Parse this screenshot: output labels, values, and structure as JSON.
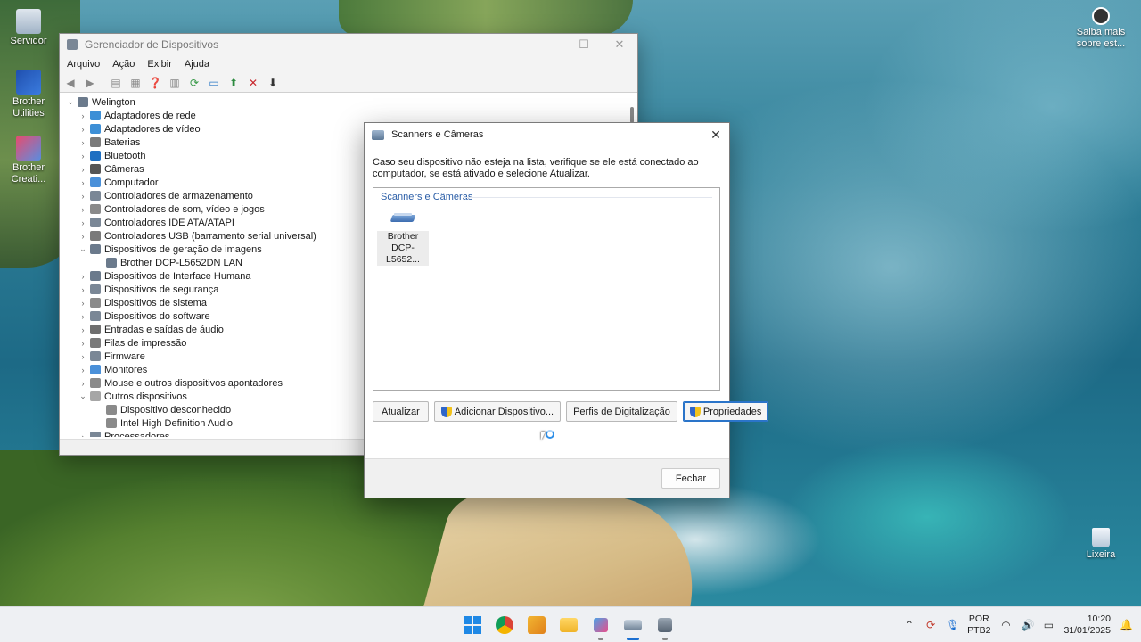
{
  "desktop": {
    "icons": [
      {
        "label": "Servidor"
      },
      {
        "label": "Brother Utilities"
      },
      {
        "label": "Brother Creati..."
      },
      {
        "label": "Saiba mais sobre est..."
      },
      {
        "label": "Lixeira"
      }
    ]
  },
  "device_manager": {
    "title": "Gerenciador de Dispositivos",
    "menu": [
      "Arquivo",
      "Ação",
      "Exibir",
      "Ajuda"
    ],
    "tree": [
      {
        "label": "Welington",
        "level": 0,
        "expanded": true
      },
      {
        "label": "Adaptadores de rede",
        "level": 1,
        "expanded": false
      },
      {
        "label": "Adaptadores de vídeo",
        "level": 1,
        "expanded": false
      },
      {
        "label": "Baterias",
        "level": 1,
        "expanded": false
      },
      {
        "label": "Bluetooth",
        "level": 1,
        "expanded": false
      },
      {
        "label": "Câmeras",
        "level": 1,
        "expanded": false
      },
      {
        "label": "Computador",
        "level": 1,
        "expanded": false
      },
      {
        "label": "Controladores de armazenamento",
        "level": 1,
        "expanded": false
      },
      {
        "label": "Controladores de som, vídeo e jogos",
        "level": 1,
        "expanded": false
      },
      {
        "label": "Controladores IDE ATA/ATAPI",
        "level": 1,
        "expanded": false
      },
      {
        "label": "Controladores USB (barramento serial universal)",
        "level": 1,
        "expanded": false
      },
      {
        "label": "Dispositivos de geração de imagens",
        "level": 1,
        "expanded": true
      },
      {
        "label": "Brother DCP-L5652DN LAN",
        "level": 2
      },
      {
        "label": "Dispositivos de Interface Humana",
        "level": 1,
        "expanded": false
      },
      {
        "label": "Dispositivos de segurança",
        "level": 1,
        "expanded": false
      },
      {
        "label": "Dispositivos de sistema",
        "level": 1,
        "expanded": false
      },
      {
        "label": "Dispositivos do software",
        "level": 1,
        "expanded": false
      },
      {
        "label": "Entradas e saídas de áudio",
        "level": 1,
        "expanded": false
      },
      {
        "label": "Filas de impressão",
        "level": 1,
        "expanded": false
      },
      {
        "label": "Firmware",
        "level": 1,
        "expanded": false
      },
      {
        "label": "Monitores",
        "level": 1,
        "expanded": false
      },
      {
        "label": "Mouse e outros dispositivos apontadores",
        "level": 1,
        "expanded": false
      },
      {
        "label": "Outros dispositivos",
        "level": 1,
        "expanded": true
      },
      {
        "label": "Dispositivo desconhecido",
        "level": 2
      },
      {
        "label": "Intel High Definition Audio",
        "level": 2
      },
      {
        "label": "Processadores",
        "level": 1,
        "expanded": false
      }
    ]
  },
  "dialog": {
    "title": "Scanners e Câmeras",
    "instructions": "Caso seu dispositivo não esteja na lista, verifique se ele está conectado ao computador, se está ativado e selecione Atualizar.",
    "group_header": "Scanners e Câmeras",
    "device_line1": "Brother",
    "device_line2": "DCP-L5652...",
    "buttons": {
      "refresh": "Atualizar",
      "add_device": "Adicionar Dispositivo...",
      "scan_profiles": "Perfis de Digitalização",
      "properties": "Propriedades",
      "close": "Fechar"
    }
  },
  "taskbar": {
    "lang_line1": "POR",
    "lang_line2": "PTB2",
    "time": "10:20",
    "date": "31/01/2025"
  },
  "colors": {
    "accent": "#1b6fd1",
    "group_header": "#2b5ea7"
  }
}
